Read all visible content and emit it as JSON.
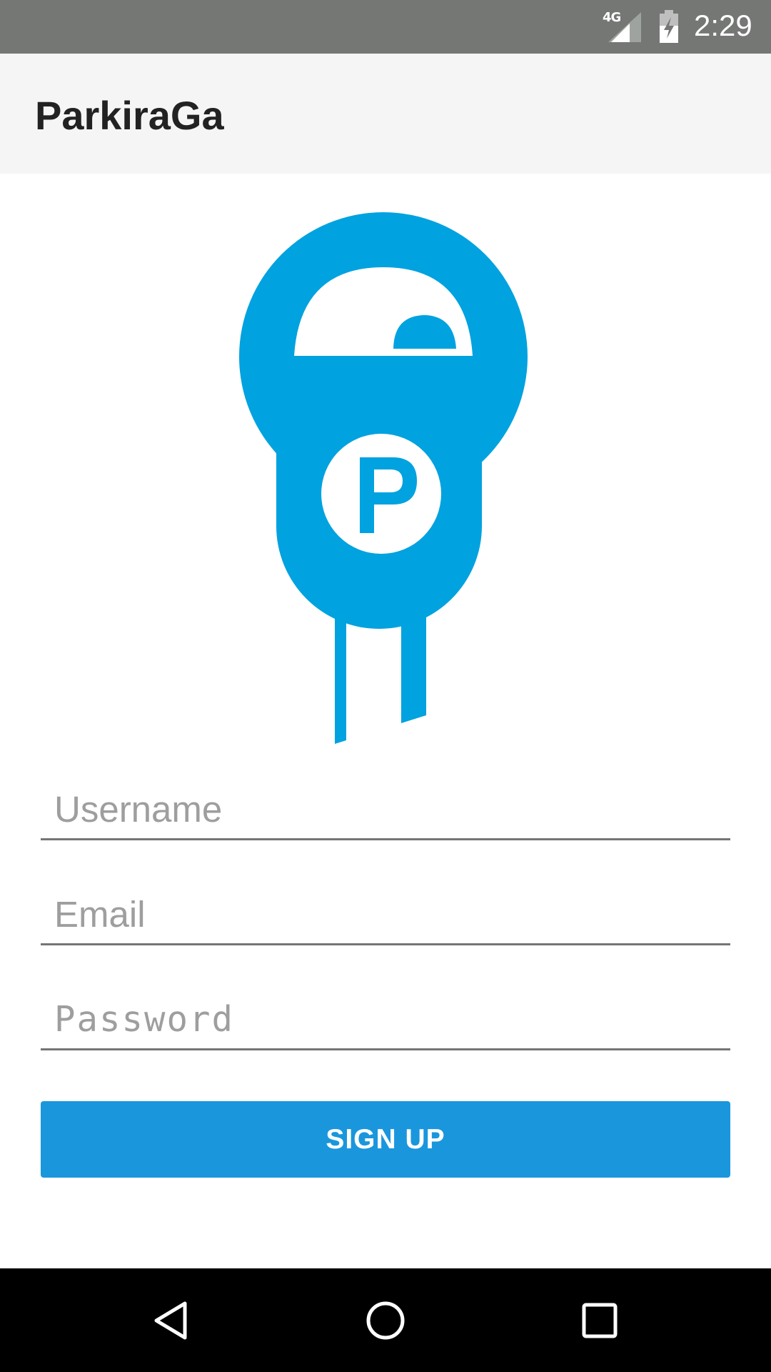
{
  "status_bar": {
    "network": "4G",
    "time": "2:29",
    "signal_icon": "cell-signal-icon",
    "battery_icon": "battery-charging-icon"
  },
  "app_bar": {
    "title": "ParkiraGa"
  },
  "logo": {
    "icon": "parking-meter-icon",
    "letter": "P",
    "color": "#00a2df"
  },
  "form": {
    "username": {
      "placeholder": "Username",
      "value": ""
    },
    "email": {
      "placeholder": "Email",
      "value": ""
    },
    "password": {
      "placeholder": "Password",
      "value": ""
    },
    "submit_label": "SIGN UP",
    "submit_color": "#1a96dd"
  },
  "nav_bar": {
    "back_icon": "back-triangle-icon",
    "home_icon": "home-circle-icon",
    "recents_icon": "recents-square-icon"
  }
}
